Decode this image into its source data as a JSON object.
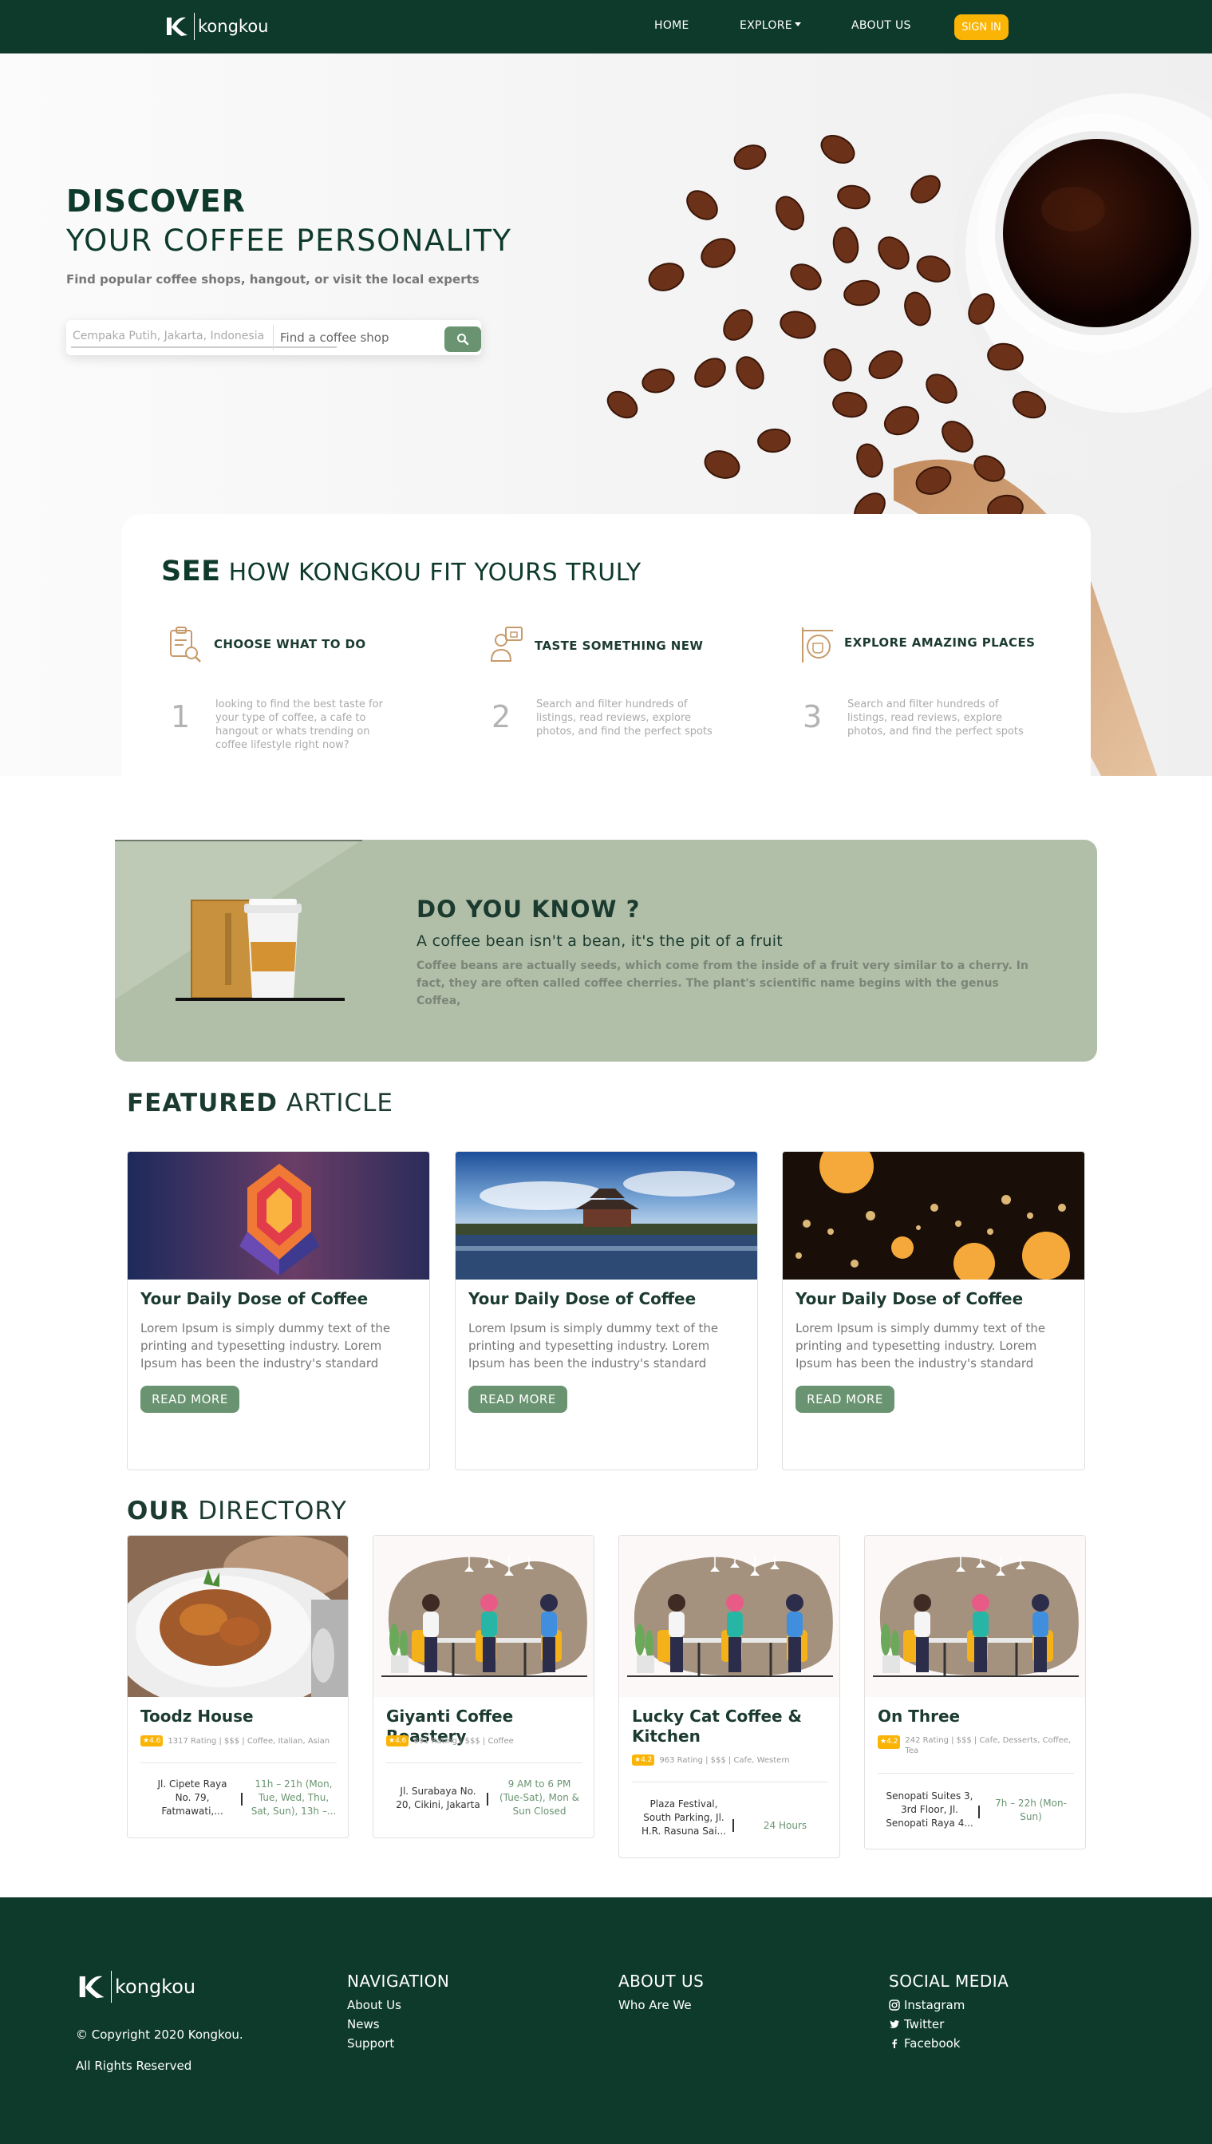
{
  "nav": {
    "logo_text": "kongkou",
    "home": "HOME",
    "explore": "EXPLORE",
    "about": "ABOUT US",
    "signin": "SIGN IN"
  },
  "hero": {
    "title_line1": "DISCOVER",
    "title_line2": "YOUR COFFEE PERSONALITY",
    "subtitle": "Find popular coffee shops, hangout, or visit the local experts",
    "location_placeholder": "Cempaka Putih, Jakarta, Indonesia",
    "shop_placeholder": "Find a coffee shop",
    "search_icon": "search-icon"
  },
  "how": {
    "title_bold": "SEE",
    "title_rest": "HOW KONGKOU FIT YOURS TRULY",
    "features": [
      {
        "icon": "clipboard-search-icon",
        "title": "CHOOSE WHAT TO DO",
        "number": "1",
        "desc": "looking to find the best taste for your type of coffee, a cafe to hangout or whats trending on coffee lifestyle right now?"
      },
      {
        "icon": "barista-icon",
        "title": "TASTE SOMETHING NEW",
        "number": "2",
        "desc": "Search and filter hundreds of listings, read reviews, explore photos, and find the perfect spots"
      },
      {
        "icon": "cafe-sign-icon",
        "title": "EXPLORE AMAZING PLACES",
        "number": "3",
        "desc": "Search and filter hundreds of listings, read reviews, explore photos, and find the perfect spots"
      }
    ]
  },
  "did_you_know": {
    "title": "DO YOU KNOW ?",
    "subtitle": "A coffee bean isn't a bean, it's the pit of a fruit",
    "body": "Coffee beans are actually seeds, which come from the inside of a fruit very similar to a cherry. In fact, they are often called coffee cherries. The plant's scientific name begins with the genus Coffea,"
  },
  "featured": {
    "title_bold": "FEATURED",
    "title_rest": "ARTICLE",
    "articles": [
      {
        "title": "Your Daily Dose of Coffee",
        "body": "Lorem Ipsum is simply dummy text of the printing and typesetting industry. Lorem Ipsum has been the industry's standard dummy text ever since",
        "button": "READ MORE"
      },
      {
        "title": "Your Daily Dose of Coffee",
        "body": "Lorem Ipsum is simply dummy text of the printing and typesetting industry. Lorem Ipsum has been the industry's standard dummy text ever since",
        "button": "READ MORE"
      },
      {
        "title": "Your Daily Dose of Coffee",
        "body": "Lorem Ipsum is simply dummy text of the printing and typesetting industry. Lorem Ipsum has been the industry's standard dummy text ever since",
        "button": "READ MORE"
      }
    ]
  },
  "directory": {
    "title_bold": "OUR",
    "title_rest": "DIRECTORY",
    "items": [
      {
        "name": "Toodz House",
        "rating": "4.6",
        "meta": "1317 Rating | $$$ | Coffee, Italian, Asian",
        "address": "Jl. Cipete Raya No. 79, Fatmawati,...",
        "hours": "11h – 21h (Mon, Tue, Wed, Thu, Sat, Sun), 13h –..."
      },
      {
        "name": "Giyanti Coffee Roastery",
        "rating": "4.6",
        "meta": "691 Rating | $$$ | Coffee",
        "address": "Jl. Surabaya No. 20, Cikini, Jakarta",
        "hours": "9 AM to 6 PM (Tue-Sat), Mon & Sun Closed"
      },
      {
        "name": "Lucky Cat Coffee & Kitchen",
        "rating": "4.2",
        "meta": "963 Rating | $$$ | Cafe, Western",
        "address": "Plaza Festival, South Parking, Jl. H.R. Rasuna Sai...",
        "hours": "24 Hours"
      },
      {
        "name": "On Three",
        "rating": "4.2",
        "meta": "242 Rating | $$$ | Cafe, Desserts, Coffee, Tea",
        "address": "Senopati Suites 3, 3rd Floor, Jl. Senopati Raya 4...",
        "hours": "7h – 22h (Mon-Sun)"
      }
    ]
  },
  "footer": {
    "logo_text": "kongkou",
    "copyright": "© Copyright 2020 Kongkou.",
    "rights": "All Rights Reserved",
    "navigation_title": "NAVIGATION",
    "navigation_links": [
      "About Us",
      "News",
      "Support"
    ],
    "about_title": "ABOUT US",
    "about_links": [
      "Who Are We"
    ],
    "social_title": "SOCIAL MEDIA",
    "social_links": [
      "Instagram",
      "Twitter",
      "Facebook"
    ]
  },
  "colors": {
    "brand_dark": "#0e3a2c",
    "accent_green": "#6a9471",
    "accent_yellow": "#f9b406",
    "sage": "#b1bfa8"
  }
}
